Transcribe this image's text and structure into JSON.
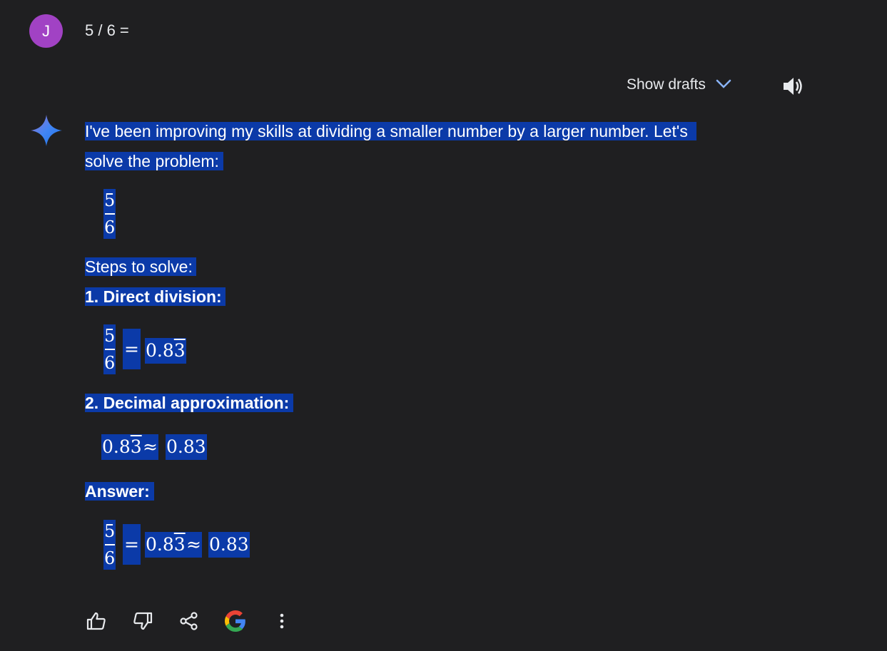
{
  "user": {
    "avatar_letter": "J",
    "prompt": "5 / 6 ="
  },
  "toolbar": {
    "show_drafts": "Show drafts"
  },
  "response": {
    "intro_line1": "I've been improving my skills at dividing a smaller number by a larger number. Let's",
    "intro_line2": "solve the problem:",
    "fraction": {
      "numerator": "5",
      "denominator": "6"
    },
    "steps_label": "Steps to solve:",
    "step1_heading": "1. Direct division:",
    "step1_eq": "=",
    "step1_result_int": "0.8",
    "step1_result_rep": "3",
    "step2_heading": "2. Decimal approximation:",
    "step2_left_int": "0.8",
    "step2_left_rep": "3",
    "step2_approx": "≈",
    "step2_right": "0.83",
    "answer_heading": "Answer:",
    "answer_eq": "=",
    "answer_mid_int": "0.8",
    "answer_mid_rep": "3",
    "answer_approx": "≈",
    "answer_right": "0.83"
  },
  "colors": {
    "background": "#1f1f21",
    "highlight": "#0b3aa8",
    "avatar": "#a142c4",
    "chevron": "#8ab4f8"
  }
}
